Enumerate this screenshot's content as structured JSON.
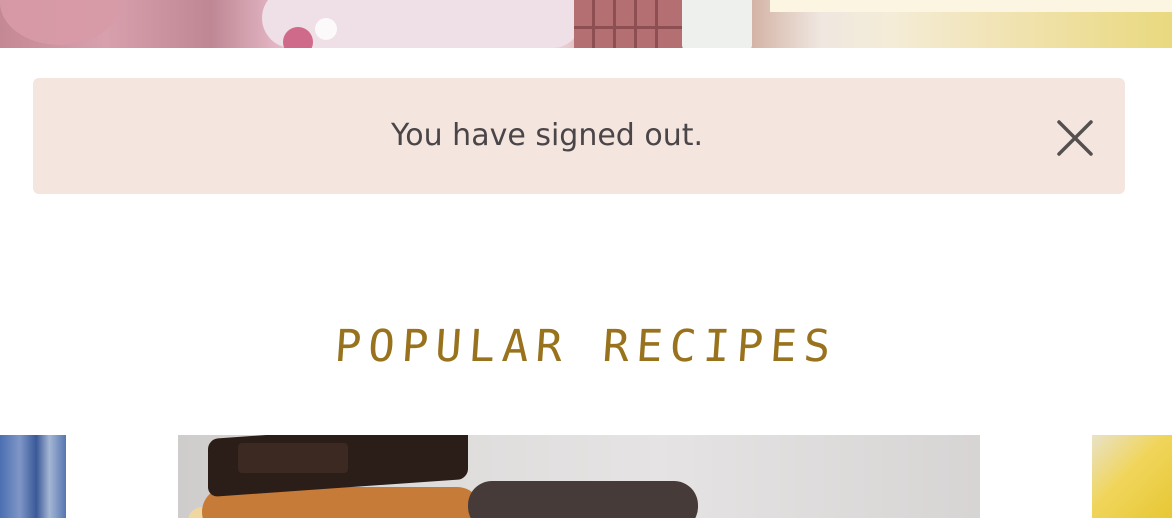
{
  "alert": {
    "message": "You have signed out.",
    "close_icon": "close-icon"
  },
  "section": {
    "title": "POPULAR RECIPES"
  },
  "colors": {
    "alert_background": "#f4e5de",
    "alert_text": "#4a4548",
    "title_color": "#98721d"
  }
}
